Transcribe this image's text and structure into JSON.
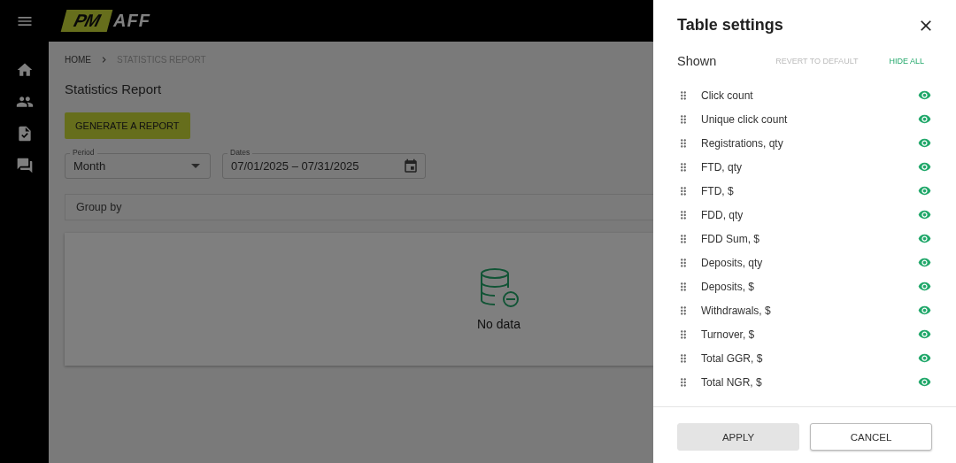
{
  "logo": {
    "left": "PM",
    "right": "AFF"
  },
  "breadcrumbs": [
    {
      "label": "HOME",
      "current": false
    },
    {
      "label": "STATISTICS REPORT",
      "current": true
    }
  ],
  "page_title": "Statistics Report",
  "generate_button": "GENERATE A REPORT",
  "filters": [
    {
      "kind": "select",
      "label": "Period",
      "value": "Month"
    },
    {
      "kind": "date",
      "label": "Dates",
      "value": "07/01/2025 – 07/31/2025"
    }
  ],
  "group_by": {
    "placeholder": "Group by"
  },
  "empty_state": "No data",
  "table_settings": {
    "title": "Table settings",
    "section": "Shown",
    "revert_button": {
      "label": "REVERT TO DEFAULT",
      "disabled": true
    },
    "hide_all_button": {
      "label": "HIDE ALL",
      "disabled": false
    },
    "columns": [
      {
        "label": "Click count",
        "visible": true
      },
      {
        "label": "Unique click count",
        "visible": true
      },
      {
        "label": "Registrations, qty",
        "visible": true
      },
      {
        "label": "FTD, qty",
        "visible": true
      },
      {
        "label": "FTD, $",
        "visible": true
      },
      {
        "label": "FDD, qty",
        "visible": true
      },
      {
        "label": "FDD Sum, $",
        "visible": true
      },
      {
        "label": "Deposits, qty",
        "visible": true
      },
      {
        "label": "Deposits, $",
        "visible": true
      },
      {
        "label": "Withdrawals, $",
        "visible": true
      },
      {
        "label": "Turnover, $",
        "visible": true
      },
      {
        "label": "Total GGR, $",
        "visible": true
      },
      {
        "label": "Total NGR, $",
        "visible": true
      }
    ],
    "apply_button": {
      "label": "APPLY",
      "disabled": true
    },
    "cancel_button": {
      "label": "CANCEL",
      "disabled": false
    }
  }
}
